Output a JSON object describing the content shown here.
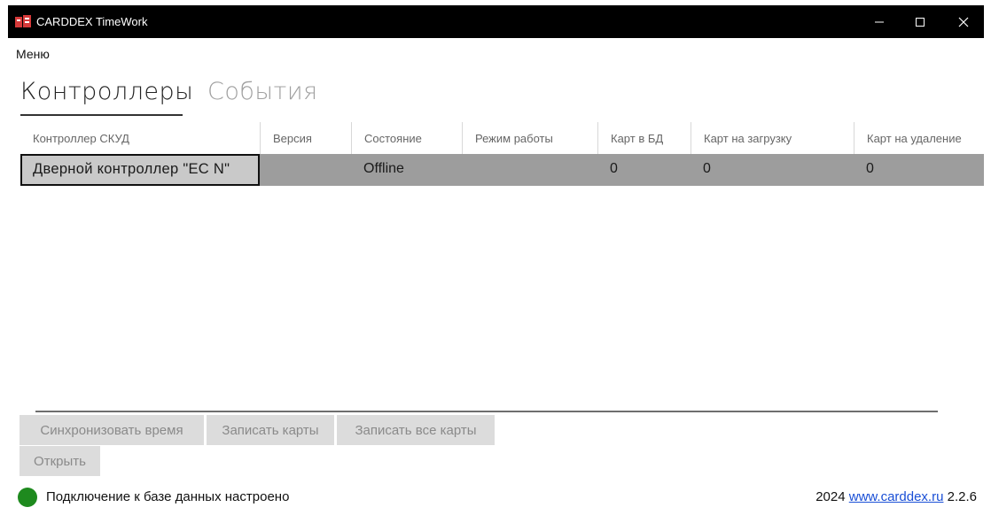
{
  "window": {
    "title": "CARDDEX TimeWork",
    "controls": {
      "minimize": "—",
      "maximize": "☐",
      "close": "✕"
    }
  },
  "menu": {
    "label": "Меню"
  },
  "tabs": [
    {
      "label": "Контроллеры",
      "active": true
    },
    {
      "label": "События",
      "active": false
    }
  ],
  "table": {
    "columns": [
      "Контроллер СКУД",
      "Версия",
      "Состояние",
      "Режим работы",
      "Карт в БД",
      "Карт на загрузку",
      "Карт на удаление"
    ],
    "rows": [
      {
        "controller": "Дверной контроллер \"EC N\"",
        "version": "",
        "state": "Offline",
        "mode": "",
        "cards_db": "0",
        "cards_upload": "0",
        "cards_delete": "0",
        "selected": true
      }
    ]
  },
  "buttons": {
    "sync_time": "Синхронизовать время",
    "write_cards": "Записать карты",
    "write_all_cards": "Записать все карты",
    "open": "Открыть"
  },
  "status": {
    "text": "Подключение к базе данных настроено",
    "color": "#1e8a1e"
  },
  "footer": {
    "year": "2024",
    "link": "www.carddex.ru",
    "version": "2.2.6"
  },
  "icons": {
    "app": "carddex-logo-icon",
    "status": "green-dot-icon"
  }
}
